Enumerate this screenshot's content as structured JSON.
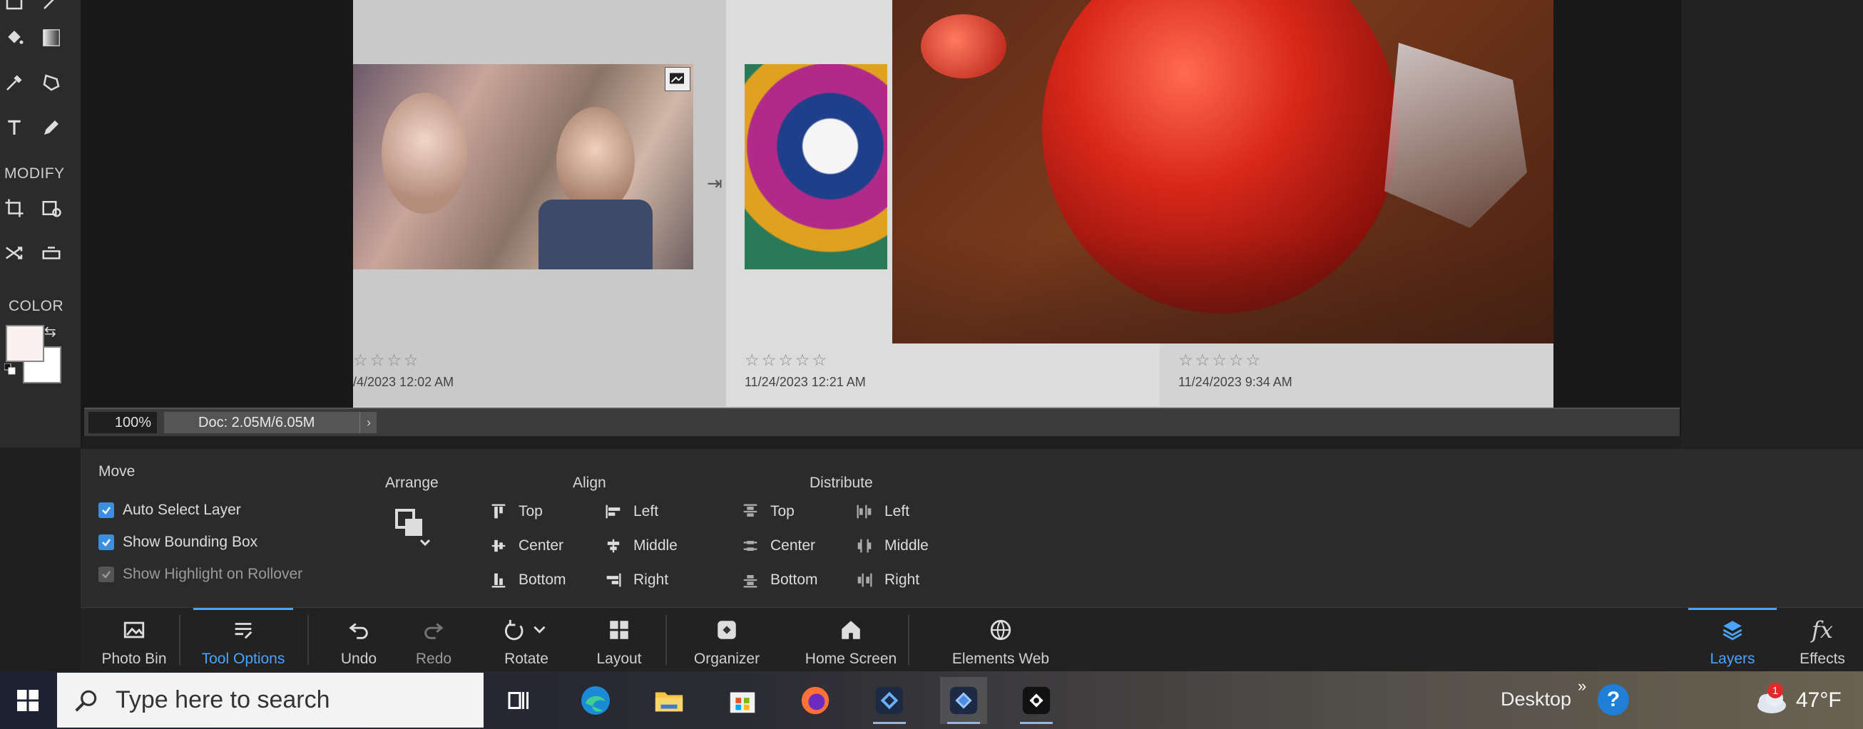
{
  "toolbar": {
    "modify_label": "MODIFY",
    "color_label": "COLOR",
    "foreground_color": "#fbf1f1",
    "background_color": "#ffffff"
  },
  "document": {
    "thumbnails": [
      {
        "stars": "☆☆☆☆",
        "date": "/4/2023 12:02 AM"
      },
      {
        "stars": "☆☆☆☆☆",
        "date": "11/24/2023 12:21 AM"
      },
      {
        "stars": "☆☆☆☆☆",
        "date": "11/24/2023 9:34 AM"
      }
    ],
    "zoom": "100%",
    "doc_info": "Doc: 2.05M/6.05M"
  },
  "tool_options": {
    "tool_name": "Move",
    "auto_select_layer": "Auto Select Layer",
    "show_bounding_box": "Show Bounding Box",
    "show_highlight": "Show Highlight on Rollover",
    "arrange_title": "Arrange",
    "align_title": "Align",
    "align_items": [
      "Top",
      "Center",
      "Bottom",
      "Left",
      "Middle",
      "Right"
    ],
    "distribute_title": "Distribute",
    "distribute_items": [
      "Top",
      "Center",
      "Bottom",
      "Left",
      "Middle",
      "Right"
    ]
  },
  "actionbar": {
    "items": [
      "Photo Bin",
      "Tool Options",
      "Undo",
      "Redo",
      "Rotate",
      "Layout",
      "Organizer",
      "Home Screen",
      "Elements Web",
      "Layers",
      "Effects"
    ]
  },
  "taskbar": {
    "search_placeholder": "Type here to search",
    "desktop_label": "Desktop",
    "weather": "47°F",
    "weather_badge": "1"
  },
  "colors": {
    "accent": "#4aa3ff",
    "checkbox": "#3b8ee0"
  }
}
